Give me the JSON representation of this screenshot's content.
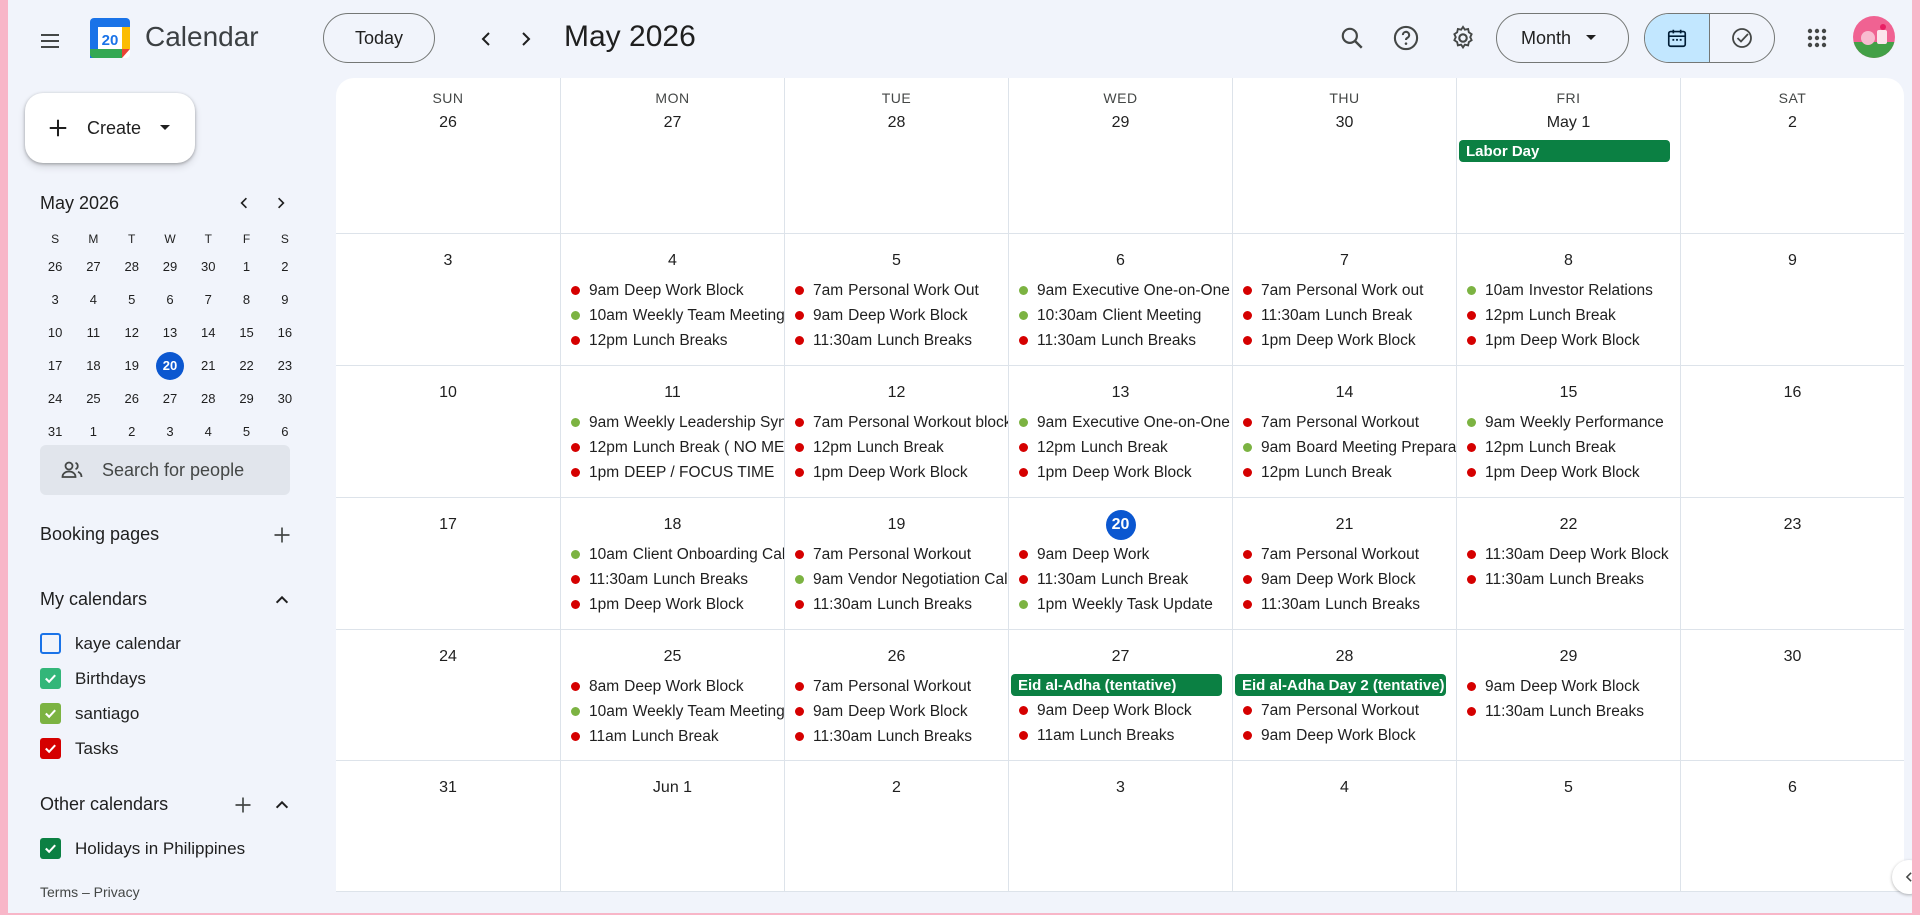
{
  "header": {
    "app_title": "Calendar",
    "logo_number": "20",
    "today_label": "Today",
    "month_title": "May 2026",
    "view_label": "Month"
  },
  "sidebar": {
    "create_label": "Create",
    "mini": {
      "title": "May 2026",
      "dow": [
        "S",
        "M",
        "T",
        "W",
        "T",
        "F",
        "S"
      ],
      "weeks": [
        [
          "26",
          "27",
          "28",
          "29",
          "30",
          "1",
          "2"
        ],
        [
          "3",
          "4",
          "5",
          "6",
          "7",
          "8",
          "9"
        ],
        [
          "10",
          "11",
          "12",
          "13",
          "14",
          "15",
          "16"
        ],
        [
          "17",
          "18",
          "19",
          "20",
          "21",
          "22",
          "23"
        ],
        [
          "24",
          "25",
          "26",
          "27",
          "28",
          "29",
          "30"
        ],
        [
          "31",
          "1",
          "2",
          "3",
          "4",
          "5",
          "6"
        ]
      ],
      "today": "20"
    },
    "people_search_placeholder": "Search for people",
    "booking_pages": "Booking pages",
    "my_calendars": "My calendars",
    "calendars": [
      {
        "label": "kaye calendar",
        "checked": false,
        "color": "#1a73e8"
      },
      {
        "label": "Birthdays",
        "checked": true,
        "color": "#33b679"
      },
      {
        "label": "santiago",
        "checked": true,
        "color": "#7cb342"
      },
      {
        "label": "Tasks",
        "checked": true,
        "color": "#d50000"
      }
    ],
    "other_calendars": "Other calendars",
    "other": [
      {
        "label": "Holidays in Philippines",
        "checked": true,
        "color": "#0b8043"
      }
    ],
    "footer": "Terms – Privacy"
  },
  "colors": {
    "red": "#d50000",
    "green": "#7cb342",
    "holiday": "#0b8043",
    "today": "#0b57d0"
  },
  "grid": {
    "dow": [
      "SUN",
      "MON",
      "TUE",
      "WED",
      "THU",
      "FRI",
      "SAT"
    ],
    "weeks": [
      [
        {
          "date": "26",
          "events": []
        },
        {
          "date": "27",
          "events": []
        },
        {
          "date": "28",
          "events": []
        },
        {
          "date": "29",
          "events": []
        },
        {
          "date": "30",
          "events": []
        },
        {
          "date": "May 1",
          "allday": "Labor Day",
          "events": []
        },
        {
          "date": "2",
          "events": []
        }
      ],
      [
        {
          "date": "3",
          "events": []
        },
        {
          "date": "4",
          "events": [
            {
              "time": "9am",
              "title": "Deep Work Block",
              "color": "red"
            },
            {
              "time": "10am",
              "title": "Weekly Team Meeting",
              "color": "green"
            },
            {
              "time": "12pm",
              "title": "Lunch Breaks",
              "color": "red"
            }
          ]
        },
        {
          "date": "5",
          "events": [
            {
              "time": "7am",
              "title": "Personal Work Out",
              "color": "red"
            },
            {
              "time": "9am",
              "title": "Deep Work Block",
              "color": "red"
            },
            {
              "time": "11:30am",
              "title": "Lunch Breaks",
              "color": "red"
            }
          ]
        },
        {
          "date": "6",
          "events": [
            {
              "time": "9am",
              "title": "Executive One-on-One",
              "color": "green"
            },
            {
              "time": "10:30am",
              "title": "Client Meeting",
              "color": "green"
            },
            {
              "time": "11:30am",
              "title": "Lunch Breaks",
              "color": "red"
            }
          ]
        },
        {
          "date": "7",
          "events": [
            {
              "time": "7am",
              "title": "Personal Work out",
              "color": "red"
            },
            {
              "time": "11:30am",
              "title": "Lunch Break",
              "color": "red"
            },
            {
              "time": "1pm",
              "title": "Deep Work Block",
              "color": "red"
            }
          ]
        },
        {
          "date": "8",
          "events": [
            {
              "time": "10am",
              "title": "Investor Relations",
              "color": "green"
            },
            {
              "time": "12pm",
              "title": "Lunch Break",
              "color": "red"
            },
            {
              "time": "1pm",
              "title": "Deep Work Block",
              "color": "red"
            }
          ]
        },
        {
          "date": "9",
          "events": []
        }
      ],
      [
        {
          "date": "10",
          "events": []
        },
        {
          "date": "11",
          "events": [
            {
              "time": "9am",
              "title": "Weekly Leadership Sync",
              "color": "green"
            },
            {
              "time": "12pm",
              "title": "Lunch Break ( NO MEETINGS)",
              "color": "red"
            },
            {
              "time": "1pm",
              "title": "DEEP / FOCUS TIME",
              "color": "red"
            }
          ]
        },
        {
          "date": "12",
          "events": [
            {
              "time": "7am",
              "title": "Personal Workout block",
              "color": "red"
            },
            {
              "time": "12pm",
              "title": "Lunch Break",
              "color": "red"
            },
            {
              "time": "1pm",
              "title": "Deep Work Block",
              "color": "red"
            }
          ]
        },
        {
          "date": "13",
          "events": [
            {
              "time": "9am",
              "title": "Executive One-on-One",
              "color": "green"
            },
            {
              "time": "12pm",
              "title": "Lunch Break",
              "color": "red"
            },
            {
              "time": "1pm",
              "title": "Deep Work Block",
              "color": "red"
            }
          ]
        },
        {
          "date": "14",
          "events": [
            {
              "time": "7am",
              "title": "Personal Workout",
              "color": "red"
            },
            {
              "time": "9am",
              "title": "Board Meeting Preparation",
              "color": "green"
            },
            {
              "time": "12pm",
              "title": "Lunch Break",
              "color": "red"
            }
          ]
        },
        {
          "date": "15",
          "events": [
            {
              "time": "9am",
              "title": "Weekly Performance",
              "color": "green"
            },
            {
              "time": "12pm",
              "title": "Lunch Break",
              "color": "red"
            },
            {
              "time": "1pm",
              "title": "Deep Work Block",
              "color": "red"
            }
          ]
        },
        {
          "date": "16",
          "events": []
        }
      ],
      [
        {
          "date": "17",
          "events": []
        },
        {
          "date": "18",
          "events": [
            {
              "time": "10am",
              "title": "Client Onboarding Call",
              "color": "green"
            },
            {
              "time": "11:30am",
              "title": "Lunch Breaks",
              "color": "red"
            },
            {
              "time": "1pm",
              "title": "Deep Work Block",
              "color": "red"
            }
          ]
        },
        {
          "date": "19",
          "events": [
            {
              "time": "7am",
              "title": "Personal Workout",
              "color": "red"
            },
            {
              "time": "9am",
              "title": "Vendor Negotiation Call",
              "color": "green"
            },
            {
              "time": "11:30am",
              "title": "Lunch Breaks",
              "color": "red"
            }
          ]
        },
        {
          "date": "20",
          "today": true,
          "events": [
            {
              "time": "9am",
              "title": "Deep Work",
              "color": "red"
            },
            {
              "time": "11:30am",
              "title": "Lunch Break",
              "color": "red"
            },
            {
              "time": "1pm",
              "title": "Weekly Task Update",
              "color": "green"
            }
          ]
        },
        {
          "date": "21",
          "events": [
            {
              "time": "7am",
              "title": "Personal Workout",
              "color": "red"
            },
            {
              "time": "9am",
              "title": "Deep Work Block",
              "color": "red"
            },
            {
              "time": "11:30am",
              "title": "Lunch Breaks",
              "color": "red"
            }
          ]
        },
        {
          "date": "22",
          "events": [
            {
              "time": "11:30am",
              "title": "Deep Work Block",
              "color": "red"
            },
            {
              "time": "11:30am",
              "title": "Lunch Breaks",
              "color": "red"
            }
          ]
        },
        {
          "date": "23",
          "events": []
        }
      ],
      [
        {
          "date": "24",
          "events": []
        },
        {
          "date": "25",
          "events": [
            {
              "time": "8am",
              "title": "Deep Work Block",
              "color": "red"
            },
            {
              "time": "10am",
              "title": "Weekly Team Meeting",
              "color": "green"
            },
            {
              "time": "11am",
              "title": "Lunch Break",
              "color": "red"
            }
          ]
        },
        {
          "date": "26",
          "events": [
            {
              "time": "7am",
              "title": "Personal Workout",
              "color": "red"
            },
            {
              "time": "9am",
              "title": "Deep Work Block",
              "color": "red"
            },
            {
              "time": "11:30am",
              "title": "Lunch Breaks",
              "color": "red"
            }
          ]
        },
        {
          "date": "27",
          "allday": "Eid al-Adha (tentative)",
          "events": [
            {
              "time": "9am",
              "title": "Deep Work Block",
              "color": "red"
            },
            {
              "time": "11am",
              "title": "Lunch Breaks",
              "color": "red"
            }
          ]
        },
        {
          "date": "28",
          "allday": "Eid al-Adha Day 2 (tentative)",
          "events": [
            {
              "time": "7am",
              "title": "Personal Workout",
              "color": "red"
            },
            {
              "time": "9am",
              "title": "Deep Work Block",
              "color": "red"
            }
          ]
        },
        {
          "date": "29",
          "events": [
            {
              "time": "9am",
              "title": "Deep Work Block",
              "color": "red"
            },
            {
              "time": "11:30am",
              "title": "Lunch Breaks",
              "color": "red"
            }
          ]
        },
        {
          "date": "30",
          "events": []
        }
      ],
      [
        {
          "date": "31",
          "events": []
        },
        {
          "date": "Jun 1",
          "events": []
        },
        {
          "date": "2",
          "events": []
        },
        {
          "date": "3",
          "events": []
        },
        {
          "date": "4",
          "events": []
        },
        {
          "date": "5",
          "events": []
        },
        {
          "date": "6",
          "events": []
        }
      ]
    ]
  }
}
